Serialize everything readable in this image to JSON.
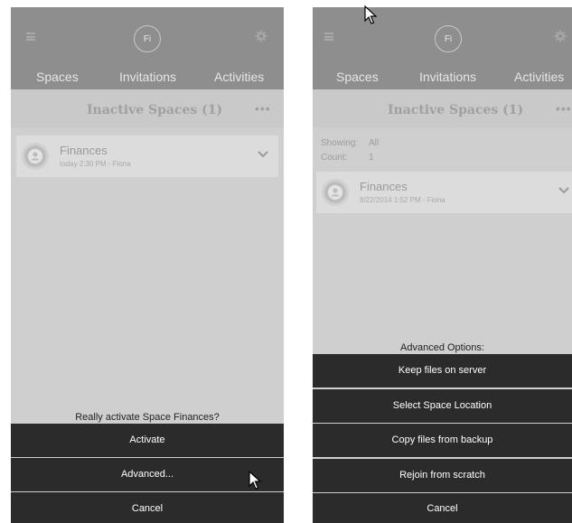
{
  "left_screen": {
    "avatar_initials": "Fi",
    "tabs": [
      "Spaces",
      "Invitations",
      "Activities"
    ],
    "header_title": "Inactive Spaces (1)",
    "more_label": "•••",
    "space": {
      "name": "Finances",
      "meta": "today 2:30 PM - Fiona"
    },
    "prompt": "Really activate Space Finances?",
    "actions": [
      "Activate",
      "Advanced...",
      "Cancel"
    ]
  },
  "right_screen": {
    "avatar_initials": "Fi",
    "tabs": [
      "Spaces",
      "Invitations",
      "Activities"
    ],
    "header_title": "Inactive Spaces (1)",
    "more_label": "•••",
    "showing_label": "Showing:",
    "showing_value": "All",
    "count_label": "Count:",
    "count_value": "1",
    "space": {
      "name": "Finances",
      "meta": "8/22/2014 1:52 PM - Fiona"
    },
    "prompt": "Advanced Options:",
    "actions": [
      "Keep files on server",
      "Select Space Location",
      "Copy files from backup",
      "Rejoin from scratch",
      "Cancel"
    ]
  },
  "icons": {
    "menu": "hamburger-menu-icon",
    "settings": "gear-icon",
    "avatar": "user-icon",
    "expand": "chevron-down-icon",
    "pointer": "mouse-cursor-icon"
  },
  "colors": {
    "topbar": "#8e8e8e",
    "background": "#cfcfcf",
    "sheet_button": "#2b2b2b",
    "card": "#dcdcdc"
  }
}
